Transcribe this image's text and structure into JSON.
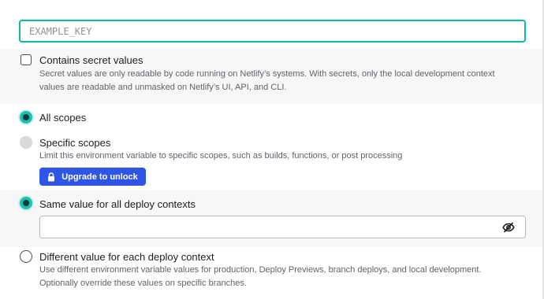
{
  "key_input": {
    "placeholder": "EXAMPLE_KEY",
    "value": ""
  },
  "secret": {
    "label": "Contains secret values",
    "description_line1": "Secret values are only readable by code running on Netlify’s systems. With secrets, only the local development context",
    "description_line2": "values are readable and unmasked on Netlify’s UI, API, and CLI.",
    "checked": false
  },
  "scopes": {
    "all_label": "All scopes",
    "specific_label": "Specific scopes",
    "specific_description": "Limit this environment variable to specific scopes, such as builds, functions, or post processing",
    "upgrade_label": "Upgrade to unlock",
    "selected": "all"
  },
  "contexts": {
    "same_label": "Same value for all deploy contexts",
    "different_label": "Different value for each deploy context",
    "different_description_line1": "Use different environment variable values for production, Deploy Previews, branch deploys, and local development.",
    "different_description_line2": "Optionally override these values on specific branches.",
    "selected": "same",
    "value": ""
  },
  "icons": {
    "lock": "lock-icon",
    "eye_off": "eye-off-icon"
  },
  "colors": {
    "accent_teal": "#1fbfb0",
    "button_blue": "#2f55e6",
    "band_gray": "#f7f7f8"
  }
}
